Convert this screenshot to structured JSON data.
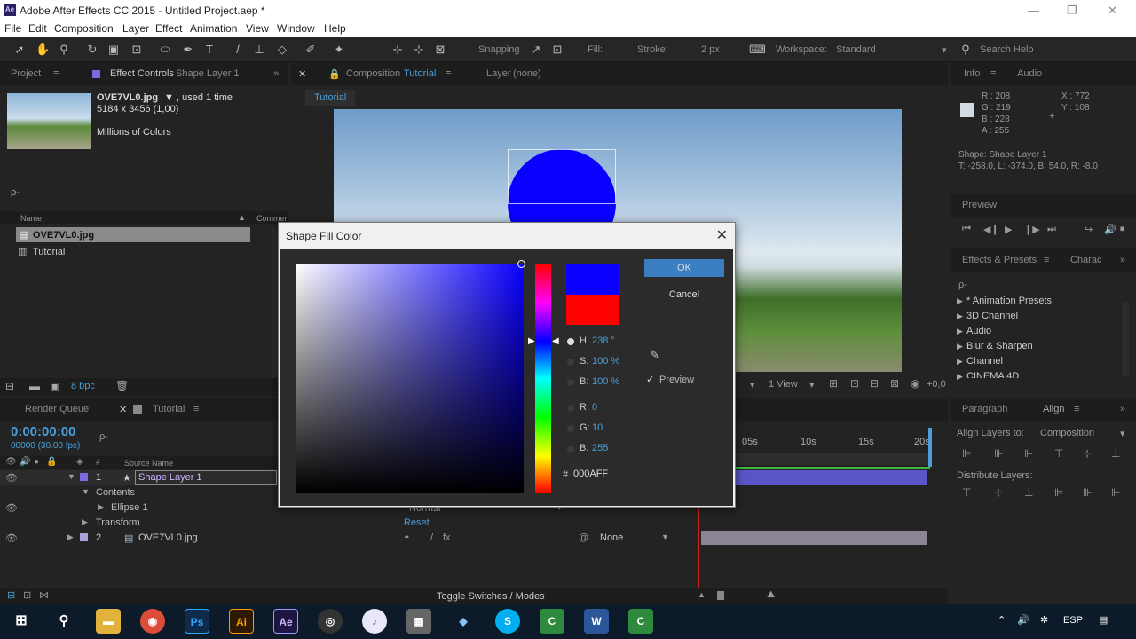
{
  "window": {
    "title": "Adobe After Effects CC 2015 - Untitled Project.aep *",
    "logo": "Ae"
  },
  "menu": [
    "File",
    "Edit",
    "Composition",
    "Layer",
    "Effect",
    "Animation",
    "View",
    "Window",
    "Help"
  ],
  "toolbar": {
    "snapping": "Snapping",
    "fill_label": "Fill:",
    "fill_color": "#0a00ff",
    "stroke_label": "Stroke:",
    "stroke_width": "2 px",
    "workspace_label": "Workspace:",
    "workspace_value": "Standard",
    "search_placeholder": "Search Help"
  },
  "project_panel": {
    "tab_project": "Project",
    "tab_effect_controls": "Effect Controls",
    "tab_effect_controls_layer": "Shape Layer 1",
    "asset_name": "OVE7VL0.jpg",
    "asset_used": ", used 1 time",
    "asset_size": "5184 x 3456 (1,00)",
    "asset_colors": "Millions of Colors",
    "search_placeholder": "ρ-",
    "col_name": "Name",
    "col_comment": "Commer",
    "items": [
      "OVE7VL0.jpg",
      "Tutorial"
    ],
    "bpc": "8 bpc"
  },
  "comp_panel": {
    "tab_composition": "Composition",
    "tab_composition_name": "Tutorial",
    "tab_layer": "Layer",
    "tab_layer_value": "(none)",
    "breadcrumb": "Tutorial",
    "view_label": "1 View",
    "offset": "+0,0"
  },
  "info_panel": {
    "tab_info": "Info",
    "tab_audio": "Audio",
    "r": "R : 208",
    "g": "G : 219",
    "b": "B : 228",
    "a": "A : 255",
    "x": "X : 772",
    "y": "Y : 108",
    "shape": "Shape: Shape Layer 1",
    "bounds": "T: -258.0, L: -374.0, B: 54.0, R: -8.0"
  },
  "preview_panel": {
    "tab": "Preview"
  },
  "effects_panel": {
    "tab": "Effects & Presets",
    "tab2": "Charac",
    "search_placeholder": "ρ-",
    "items": [
      "* Animation Presets",
      "3D Channel",
      "Audio",
      "Blur & Sharpen",
      "Channel",
      "CINEMA 4D"
    ]
  },
  "paragraph_panel": {
    "tab_paragraph": "Paragraph",
    "tab_align": "Align",
    "align_label": "Align Layers to:",
    "align_value": "Composition",
    "distribute_label": "Distribute Layers:"
  },
  "timeline": {
    "tab_render": "Render Queue",
    "tab_comp": "Tutorial",
    "timecode": "0:00:00:00",
    "fps": "00000 (30.00 fps)",
    "search_placeholder": "ρ-",
    "col_num": "#",
    "col_source": "Source Name",
    "ruler": [
      "05s",
      "10s",
      "15s",
      "20s"
    ],
    "layers": [
      {
        "num": "1",
        "name": "Shape Layer 1"
      },
      {
        "num": "",
        "name": "Contents"
      },
      {
        "num": "",
        "name": "Ellipse 1"
      },
      {
        "num": "",
        "name": "Transform"
      },
      {
        "num": "2",
        "name": "OVE7VL0.jpg"
      }
    ],
    "blend_mode": "Normal",
    "reset": "Reset",
    "parent": "None",
    "toggle": "Toggle Switches / Modes"
  },
  "dialog": {
    "title": "Shape Fill Color",
    "ok": "OK",
    "cancel": "Cancel",
    "preview": "Preview",
    "h_label": "H:",
    "h_value": "238 °",
    "s_label": "S:",
    "s_value": "100 %",
    "b_label": "B:",
    "b_value": "100 %",
    "r_label": "R:",
    "r_value": "0",
    "g_label": "G:",
    "g_value": "10",
    "bl_label": "B:",
    "bl_value": "255",
    "hex_label": "#",
    "hex_value": "000AFF",
    "new_color": "#0a00ff",
    "old_color": "#ff0000"
  },
  "taskbar": {
    "lang": "ESP",
    "apps": [
      "Ps",
      "Ai",
      "Ae",
      "W"
    ]
  }
}
